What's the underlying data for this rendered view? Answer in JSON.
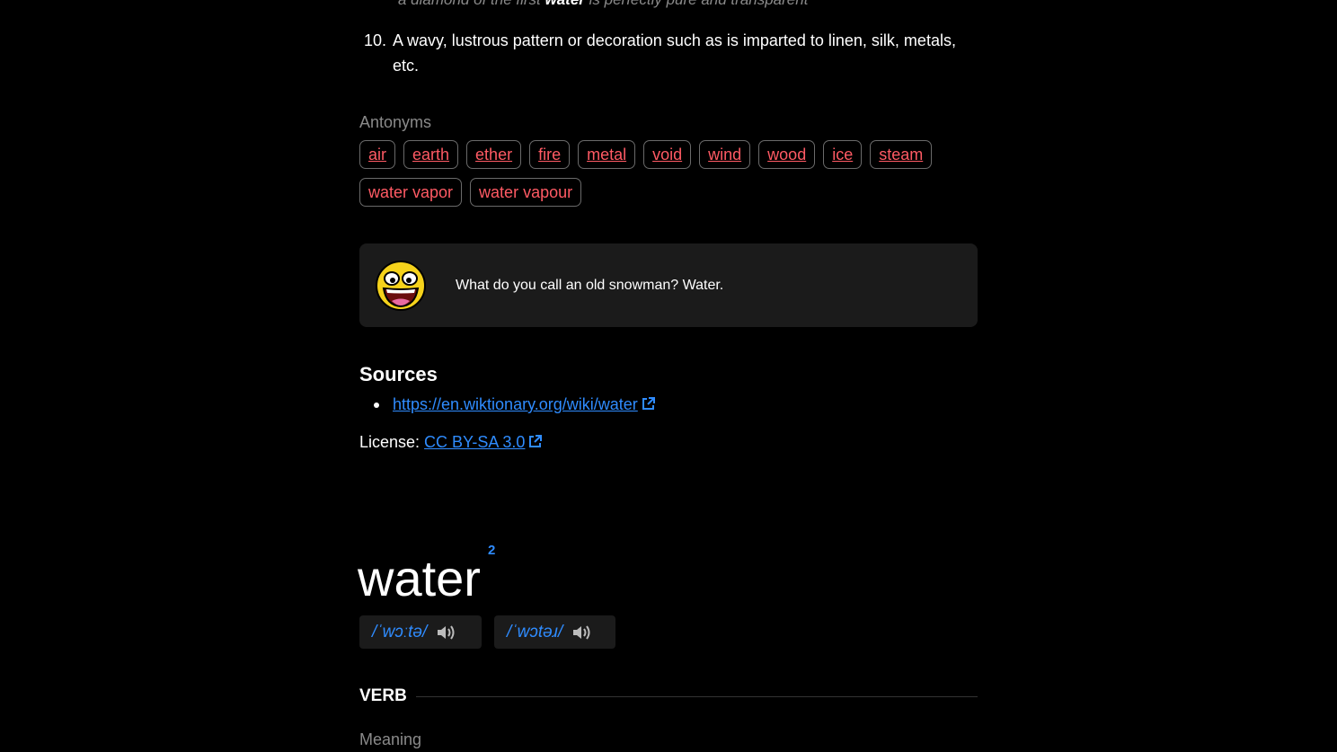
{
  "previous_entry": {
    "example": {
      "before": "a diamond of the first ",
      "bold": "water",
      "after": " is perfectly pure and transparent"
    },
    "definition": {
      "number": "10.",
      "text": "A wavy, lustrous pattern or decoration such as is imparted to linen, silk, metals, etc."
    },
    "antonyms_label": "Antonyms",
    "antonyms": [
      {
        "label": "air",
        "linked": true
      },
      {
        "label": "earth",
        "linked": true
      },
      {
        "label": "ether",
        "linked": true
      },
      {
        "label": "fire",
        "linked": true
      },
      {
        "label": "metal",
        "linked": true
      },
      {
        "label": "void",
        "linked": true
      },
      {
        "label": "wind",
        "linked": true
      },
      {
        "label": "wood",
        "linked": true
      },
      {
        "label": "ice",
        "linked": true
      },
      {
        "label": "steam",
        "linked": true
      },
      {
        "label": "water vapor",
        "linked": false
      },
      {
        "label": "water vapour",
        "linked": false
      }
    ]
  },
  "joke": {
    "icon": "laughing-face-icon",
    "text": "What do you call an old snowman? Water."
  },
  "sources": {
    "title": "Sources",
    "links": [
      "https://en.wiktionary.org/wiki/water"
    ],
    "license_prefix": "License: ",
    "license_link": "CC BY-SA 3.0"
  },
  "entry": {
    "headword": "water",
    "superscript": "2",
    "pronunciations": [
      {
        "ipa": "/ˈwɔːtə/",
        "icon": "speaker-icon"
      },
      {
        "ipa": "/ˈwɔtəɹ/",
        "icon": "speaker-icon"
      }
    ],
    "part_of_speech": "VERB",
    "meaning_label": "Meaning"
  },
  "colors": {
    "background": "#000000",
    "card": "#1b1b1b",
    "link": "#2f8cff",
    "chip_text": "#ff5a64",
    "muted": "#8a8a8a"
  }
}
